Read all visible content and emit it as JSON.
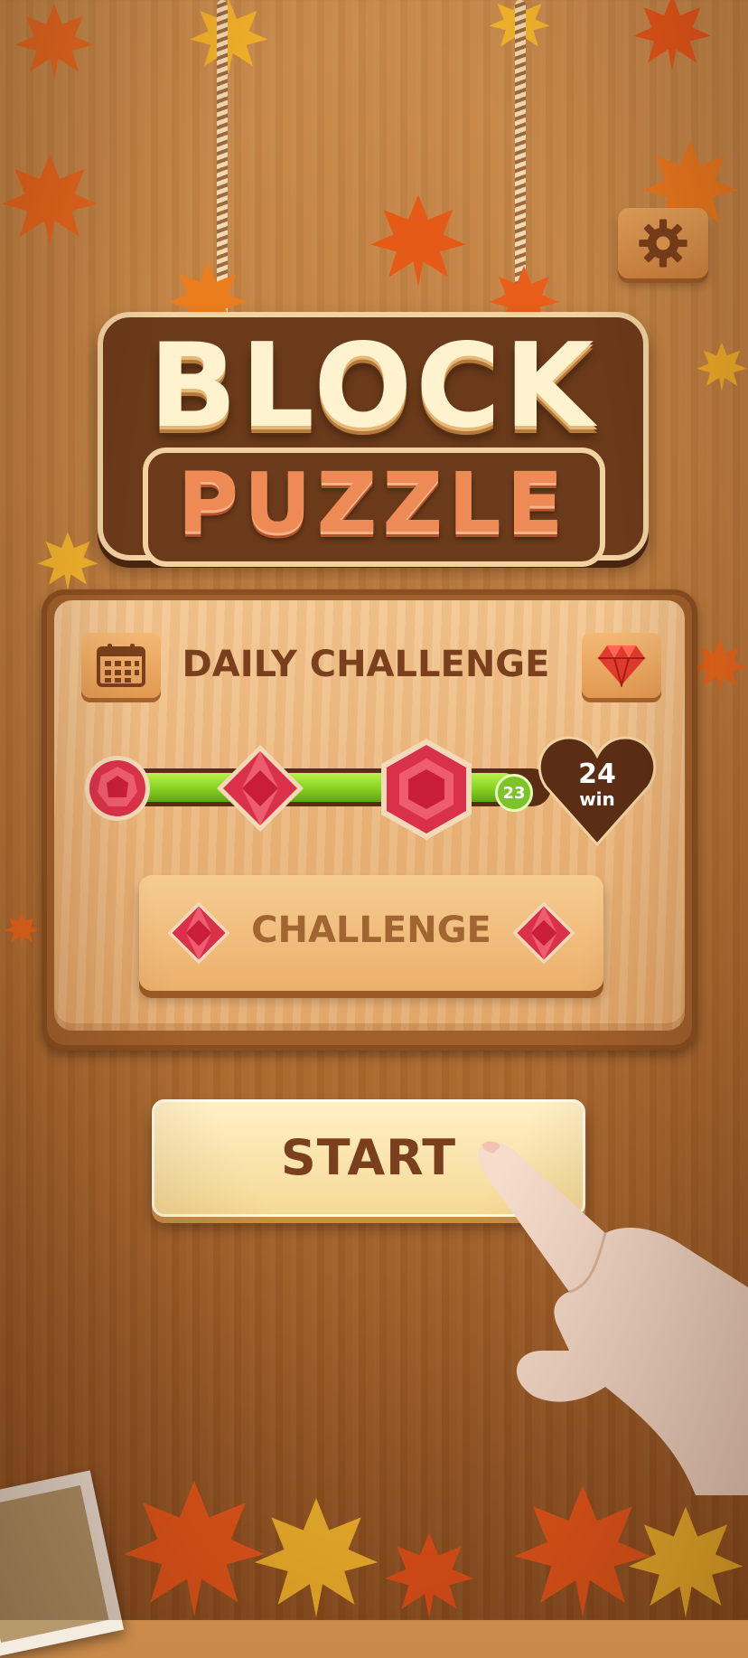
{
  "title": {
    "line1": "BLOCK",
    "line2": "PUZZLE"
  },
  "settings": {
    "icon": "gear-icon"
  },
  "daily_challenge": {
    "title": "DAILY CHALLENGE",
    "calendar_icon": "calendar-icon",
    "gem_icon": "diamond-icon",
    "progress": {
      "current": "23",
      "goal_value": "24",
      "goal_label": "win",
      "fraction": 0.93
    },
    "button_label": "CHALLENGE"
  },
  "start_button": {
    "label": "START"
  },
  "colors": {
    "accent_text": "#7a3f1c",
    "progress_green": "#86d122",
    "gem_red": "#d9314a",
    "wood": "#c07e3f"
  }
}
